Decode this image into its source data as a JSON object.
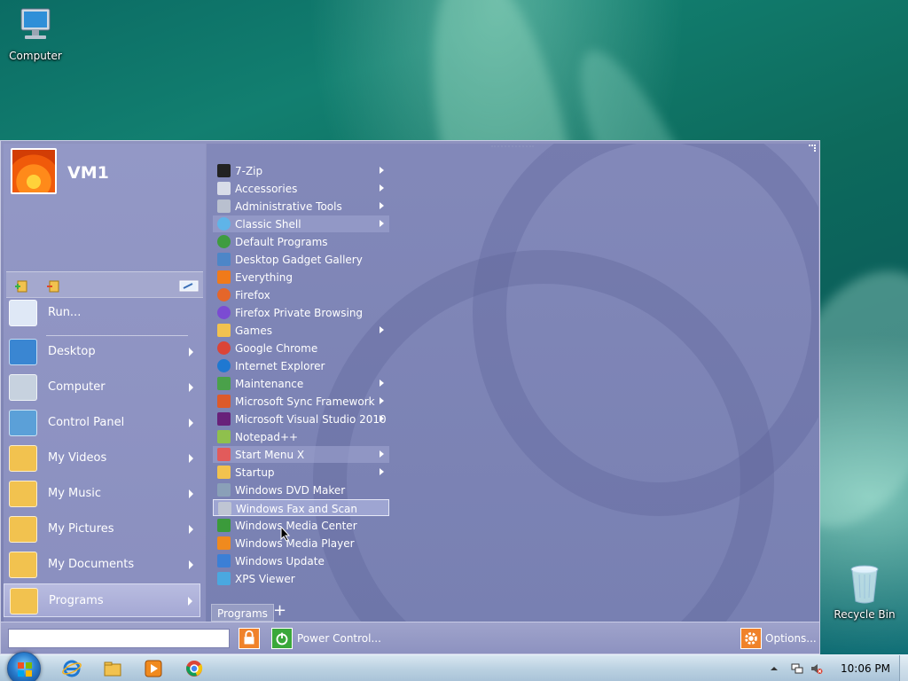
{
  "desktop": {
    "computer_icon_label": "Computer",
    "recycle_bin_label": "Recycle Bin"
  },
  "start_menu": {
    "user_name": "VM1",
    "left_items": [
      {
        "label": "Run...",
        "icon": "run-icon",
        "arrow": false
      },
      {
        "label": "Desktop",
        "icon": "desktop-icon",
        "arrow": true
      },
      {
        "label": "Computer",
        "icon": "computer-icon",
        "arrow": true
      },
      {
        "label": "Control Panel",
        "icon": "control-panel-icon",
        "arrow": true
      },
      {
        "label": "My Videos",
        "icon": "videos-folder-icon",
        "arrow": true
      },
      {
        "label": "My Music",
        "icon": "music-folder-icon",
        "arrow": true
      },
      {
        "label": "My Pictures",
        "icon": "pictures-folder-icon",
        "arrow": true
      },
      {
        "label": "My Documents",
        "icon": "documents-folder-icon",
        "arrow": true
      },
      {
        "label": "Programs",
        "icon": "programs-folder-icon",
        "arrow": true,
        "selected": true
      }
    ],
    "programs": [
      {
        "label": "7-Zip",
        "icon": "7zip-icon",
        "arrow": true
      },
      {
        "label": "Accessories",
        "icon": "accessories-icon",
        "arrow": true
      },
      {
        "label": "Administrative Tools",
        "icon": "admin-tools-icon",
        "arrow": true
      },
      {
        "label": "Classic Shell",
        "icon": "classic-shell-icon",
        "arrow": true,
        "highlight": true
      },
      {
        "label": "Default Programs",
        "icon": "default-programs-icon",
        "arrow": false
      },
      {
        "label": "Desktop Gadget Gallery",
        "icon": "gadget-gallery-icon",
        "arrow": false
      },
      {
        "label": "Everything",
        "icon": "everything-search-icon",
        "arrow": false
      },
      {
        "label": "Firefox",
        "icon": "firefox-icon",
        "arrow": false
      },
      {
        "label": "Firefox Private Browsing",
        "icon": "firefox-private-icon",
        "arrow": false
      },
      {
        "label": "Games",
        "icon": "games-folder-icon",
        "arrow": true
      },
      {
        "label": "Google Chrome",
        "icon": "chrome-icon",
        "arrow": false
      },
      {
        "label": "Internet Explorer",
        "icon": "ie-icon",
        "arrow": false
      },
      {
        "label": "Maintenance",
        "icon": "maintenance-icon",
        "arrow": true
      },
      {
        "label": "Microsoft Sync Framework",
        "icon": "sync-framework-icon",
        "arrow": true
      },
      {
        "label": "Microsoft Visual Studio 2010",
        "icon": "visual-studio-icon",
        "arrow": true
      },
      {
        "label": "Notepad++",
        "icon": "notepadpp-icon",
        "arrow": false
      },
      {
        "label": "Start Menu X",
        "icon": "start-menu-x-icon",
        "arrow": true,
        "highlight": true
      },
      {
        "label": "Startup",
        "icon": "startup-folder-icon",
        "arrow": true
      },
      {
        "label": "Windows DVD Maker",
        "icon": "dvd-maker-icon",
        "arrow": false
      },
      {
        "label": "Windows Fax and Scan",
        "icon": "fax-scan-icon",
        "arrow": false,
        "selected": true
      },
      {
        "label": "Windows Media Center",
        "icon": "media-center-icon",
        "arrow": false
      },
      {
        "label": "Windows Media Player",
        "icon": "media-player-icon",
        "arrow": false
      },
      {
        "label": "Windows Update",
        "icon": "windows-update-icon",
        "arrow": false
      },
      {
        "label": "XPS Viewer",
        "icon": "xps-viewer-icon",
        "arrow": false
      }
    ],
    "programs_tab_label": "Programs",
    "add_tab_label": "+",
    "search_placeholder": "",
    "power_control_label": "Power Control...",
    "options_label": "Options..."
  },
  "taskbar": {
    "pinned": [
      "internet-explorer-icon",
      "file-explorer-icon",
      "media-player-icon",
      "chrome-icon"
    ],
    "clock": "10:06 PM"
  },
  "colors": {
    "menu_bg": "#8287b6",
    "accent_orange": "#ff8c1a",
    "power_green": "#3aa83a"
  }
}
